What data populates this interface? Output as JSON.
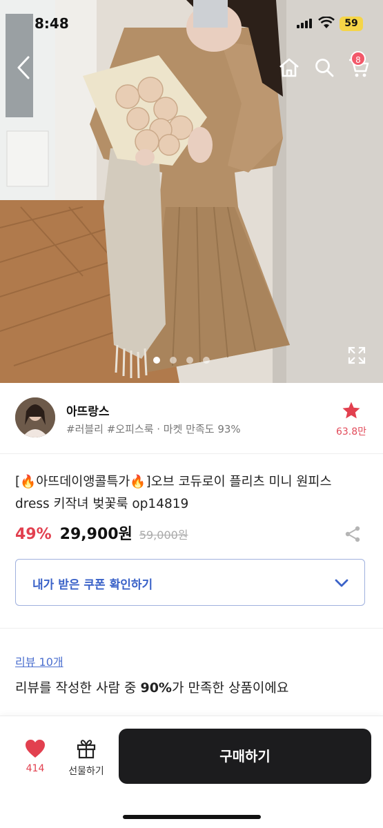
{
  "status_bar": {
    "time": "8:48",
    "battery": "59"
  },
  "header": {
    "cart_count": "8"
  },
  "carousel": {
    "total": 5,
    "active_index": 0
  },
  "seller": {
    "name": "아뜨랑스",
    "tags": "#러블리 #오피스룩 · 마켓 만족도 93%",
    "favorite_count": "63.8만"
  },
  "product": {
    "title": "[🔥아뜨데이앵콜특가🔥]오브 코듀로이 플리츠 미니 원피스 dress 키작녀 벚꽃룩 op14819",
    "discount": "49%",
    "price": "29,900원",
    "original_price": "59,000원"
  },
  "coupon": {
    "label": "내가 받은 쿠폰 확인하기"
  },
  "review": {
    "link": "리뷰 10개",
    "summary_before": "리뷰를 작성한 사람 중 ",
    "summary_percent": "90%",
    "summary_after": "가 만족한 상품이에요"
  },
  "bottom_bar": {
    "like_count": "414",
    "gift_label": "선물하기",
    "buy_label": "구매하기"
  },
  "colors": {
    "accent_red": "#e2404f",
    "coupon_blue": "#3a62c8",
    "buy_button": "#1c1c1e"
  }
}
